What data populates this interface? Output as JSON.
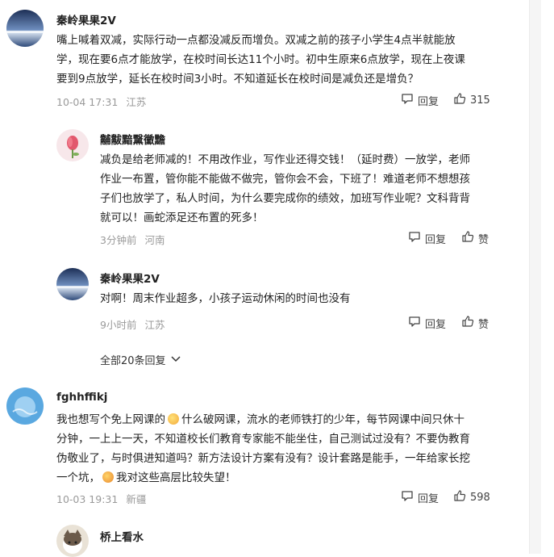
{
  "comments": [
    {
      "username": "秦岭果果2V",
      "lines": [
        "嘴上喊着双减，实际行动一点都没减反而增负。双减之前的孩子小学生4点半就能放",
        "学，现在要6点才能放学，在校时间长达11个小时。初中生原来6点放学，现在上夜课",
        "要到9点放学，延长在校时间3小时。不知道延长在校时间是减负还是增负？"
      ],
      "time": "10-04 17:31",
      "location": "江苏",
      "reply_label": "回复",
      "like_label": "315"
    },
    {
      "username": "黼黻黯黳黴黵",
      "lines": [
        "减负是给老师减的！不用改作业，写作业还得交钱！（延时费）一放学，老师",
        "作业一布置，管你能不能做不做完，管你会不会，下班了！难道老师不想想孩",
        "子们也放学了，私人时间，为什么要完成你的绩效，加班写作业呢？文科背背",
        "就可以！画蛇添足还布置的死多！"
      ],
      "time": "3分钟前",
      "location": "河南",
      "reply_label": "回复",
      "like_label": "赞"
    },
    {
      "username": "秦岭果果2V",
      "lines": [
        "对啊！周末作业超多，小孩子运动休闲的时间也没有"
      ],
      "time": "9小时前",
      "location": "江苏",
      "reply_label": "回复",
      "like_label": "赞"
    },
    {
      "username": "fghhffikj",
      "line1_a": "我也想写个免上网课的",
      "line1_b": "什么破网课，流水的老师铁打的少年，每节网课中间只休十",
      "line2": "分钟，一上上一天，不知道校长们教育专家能不能坐住，自己测试过没有？不要伪教育",
      "line3": "伪敬业了，与时俱进知道吗？新方法设计方案有没有？设计套路是能手，一年给家长挖",
      "line4_a": "一个坑，",
      "line4_b": "我对这些高层比较失望！",
      "time": "10-03 19:31",
      "location": "新疆",
      "reply_label": "回复",
      "like_label": "598"
    },
    {
      "username": "桥上看水"
    }
  ],
  "expand_label": "全部20条回复",
  "icons": {
    "reply": "comment-bubble-icon",
    "like": "thumbs-up-icon",
    "expand": "chevron-down-icon"
  }
}
